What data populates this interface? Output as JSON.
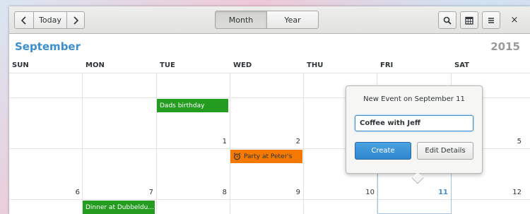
{
  "header": {
    "prev_icon": "chevron-left-icon",
    "today_label": "Today",
    "next_icon": "chevron-right-icon",
    "views": [
      {
        "label": "Month",
        "active": true
      },
      {
        "label": "Year",
        "active": false
      }
    ],
    "search_icon": "search-icon",
    "calendar_icon": "calendar-icon",
    "menu_icon": "menu-icon",
    "close_label": "×"
  },
  "calendar": {
    "month": "September",
    "year": "2015",
    "weekdays": [
      "SUN",
      "MON",
      "TUE",
      "WED",
      "THU",
      "FRI",
      "SAT"
    ],
    "day_numbers": [
      "1",
      "2",
      "5",
      "6",
      "7",
      "8",
      "9",
      "10",
      "11",
      "12"
    ],
    "today": "11",
    "events": [
      {
        "title": "Dads birthday",
        "color": "#239c1f"
      },
      {
        "title": "Party at Peter's",
        "color": "#f57900",
        "icon": "alarm-icon"
      },
      {
        "title": "Dinner at Dubbeldu...",
        "color": "#239c1f"
      }
    ]
  },
  "popover": {
    "title": "New Event on September 11",
    "input_value": "Coffee with Jeff",
    "create_label": "Create",
    "edit_label": "Edit Details"
  },
  "colors": {
    "accent": "#3b8fcf",
    "event_green": "#239c1f",
    "event_orange": "#f57900"
  }
}
